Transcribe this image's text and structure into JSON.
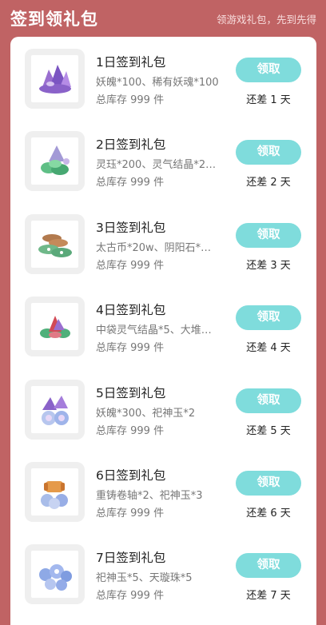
{
  "header": {
    "title": "签到领礼包",
    "subtitle": "领游戏礼包，先到先得"
  },
  "colors": {
    "background": "#c06364",
    "button": "#7fdcdc",
    "card": "#ffffff"
  },
  "packages": [
    {
      "name": "1日签到礼包",
      "desc": "妖魄*100、稀有妖魂*100",
      "stock": "总库存 999 件",
      "button": "领取",
      "remain": "还差 1 天",
      "icon": "purple-crystal-icon"
    },
    {
      "name": "2日签到礼包",
      "desc": "灵珏*200、灵气结晶*2…",
      "stock": "总库存 999 件",
      "button": "领取",
      "remain": "还差 2 天",
      "icon": "green-gem-icon"
    },
    {
      "name": "3日签到礼包",
      "desc": "太古币*20w、阴阳石*…",
      "stock": "总库存 999 件",
      "button": "领取",
      "remain": "还差 3 天",
      "icon": "coins-icon"
    },
    {
      "name": "4日签到礼包",
      "desc": "中袋灵气结晶*5、大堆…",
      "stock": "总库存 999 件",
      "button": "领取",
      "remain": "还差 4 天",
      "icon": "red-crystal-icon"
    },
    {
      "name": "5日签到礼包",
      "desc": "妖魄*300、祀神玉*2",
      "stock": "总库存 999 件",
      "button": "领取",
      "remain": "还差 5 天",
      "icon": "purple-orb-icon"
    },
    {
      "name": "6日签到礼包",
      "desc": "重铸卷轴*2、祀神玉*3",
      "stock": "总库存 999 件",
      "button": "领取",
      "remain": "还差 6 天",
      "icon": "scroll-orb-icon"
    },
    {
      "name": "7日签到礼包",
      "desc": "祀神玉*5、天璇珠*5",
      "stock": "总库存 999 件",
      "button": "领取",
      "remain": "还差 7 天",
      "icon": "blue-orb-icon"
    }
  ]
}
